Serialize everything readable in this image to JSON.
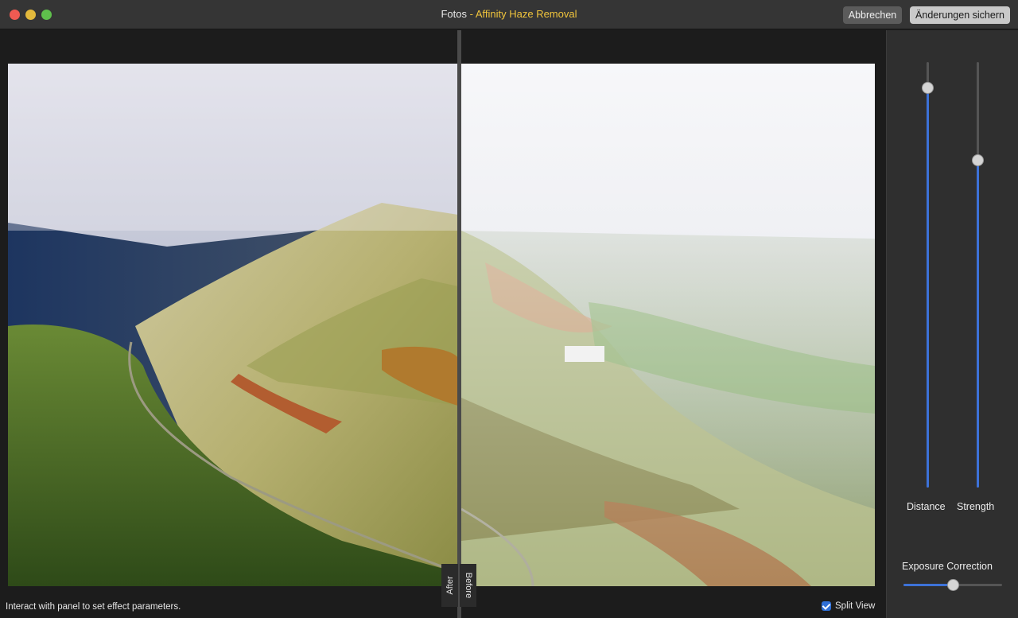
{
  "window": {
    "app_name": "Fotos",
    "separator": " - ",
    "plugin_name": "Affinity Haze Removal",
    "cancel_label": "Abbrechen",
    "save_label": "Änderungen sichern"
  },
  "canvas": {
    "after_label": "After",
    "before_label": "Before",
    "status_text": "Interact with panel to set effect parameters.",
    "split_view_label": "Split View",
    "split_view_checked": true
  },
  "panel": {
    "distance_label": "Distance",
    "distance_value": 0.94,
    "strength_label": "Strength",
    "strength_value": 0.77,
    "exposure_label": "Exposure Correction",
    "exposure_value": 0.5
  },
  "colors": {
    "accent": "#3d72d8",
    "plugin_title": "#f0c43c"
  }
}
